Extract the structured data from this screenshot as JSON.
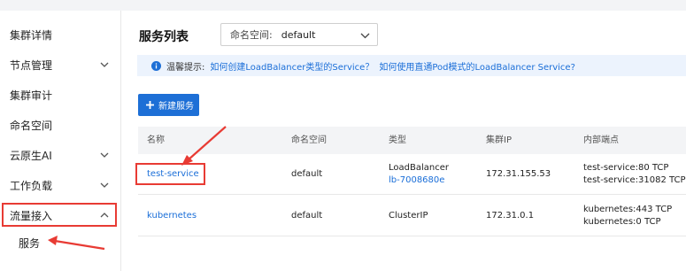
{
  "sidebar": {
    "items": [
      {
        "label": "集群详情",
        "has_chevron": false
      },
      {
        "label": "节点管理",
        "has_chevron": true
      },
      {
        "label": "集群审计",
        "has_chevron": false
      },
      {
        "label": "命名空间",
        "has_chevron": false
      },
      {
        "label": "云原生AI",
        "has_chevron": true
      },
      {
        "label": "工作负载",
        "has_chevron": true
      },
      {
        "label": "流量接入",
        "has_chevron": true,
        "expanded": true
      },
      {
        "label": "服务",
        "sub": true,
        "active": true
      }
    ]
  },
  "main": {
    "title": "服务列表",
    "namespace_select": {
      "label": "命名空间:",
      "value": "default"
    },
    "tip": {
      "label": "温馨提示:",
      "links": [
        "如何创建LoadBalancer类型的Service？",
        "如何使用直通Pod模式的LoadBalancer Service?"
      ]
    },
    "create_button": "新建服务",
    "table": {
      "columns": [
        "名称",
        "命名空间",
        "类型",
        "集群IP",
        "内部端点"
      ],
      "rows": [
        {
          "name": "test-service",
          "namespace": "default",
          "type": "LoadBalancer",
          "type_link": "lb-7008680e",
          "cluster_ip": "172.31.155.53",
          "endpoints": [
            "test-service:80 TCP",
            "test-service:31082 TCP"
          ]
        },
        {
          "name": "kubernetes",
          "namespace": "default",
          "type": "ClusterIP",
          "type_link": "",
          "cluster_ip": "172.31.0.1",
          "endpoints": [
            "kubernetes:443 TCP",
            "kubernetes:0 TCP"
          ]
        }
      ]
    }
  },
  "colors": {
    "accent": "#1d6fd6",
    "link": "#1a6ed8",
    "annotation": "#e83b34",
    "tip_bg": "#ecf3fd",
    "header_bg": "#f3f4f6"
  },
  "icons": [
    "chevron-down-icon",
    "chevron-up-icon",
    "info-icon",
    "plus-icon",
    "red-arrow-annotation"
  ]
}
